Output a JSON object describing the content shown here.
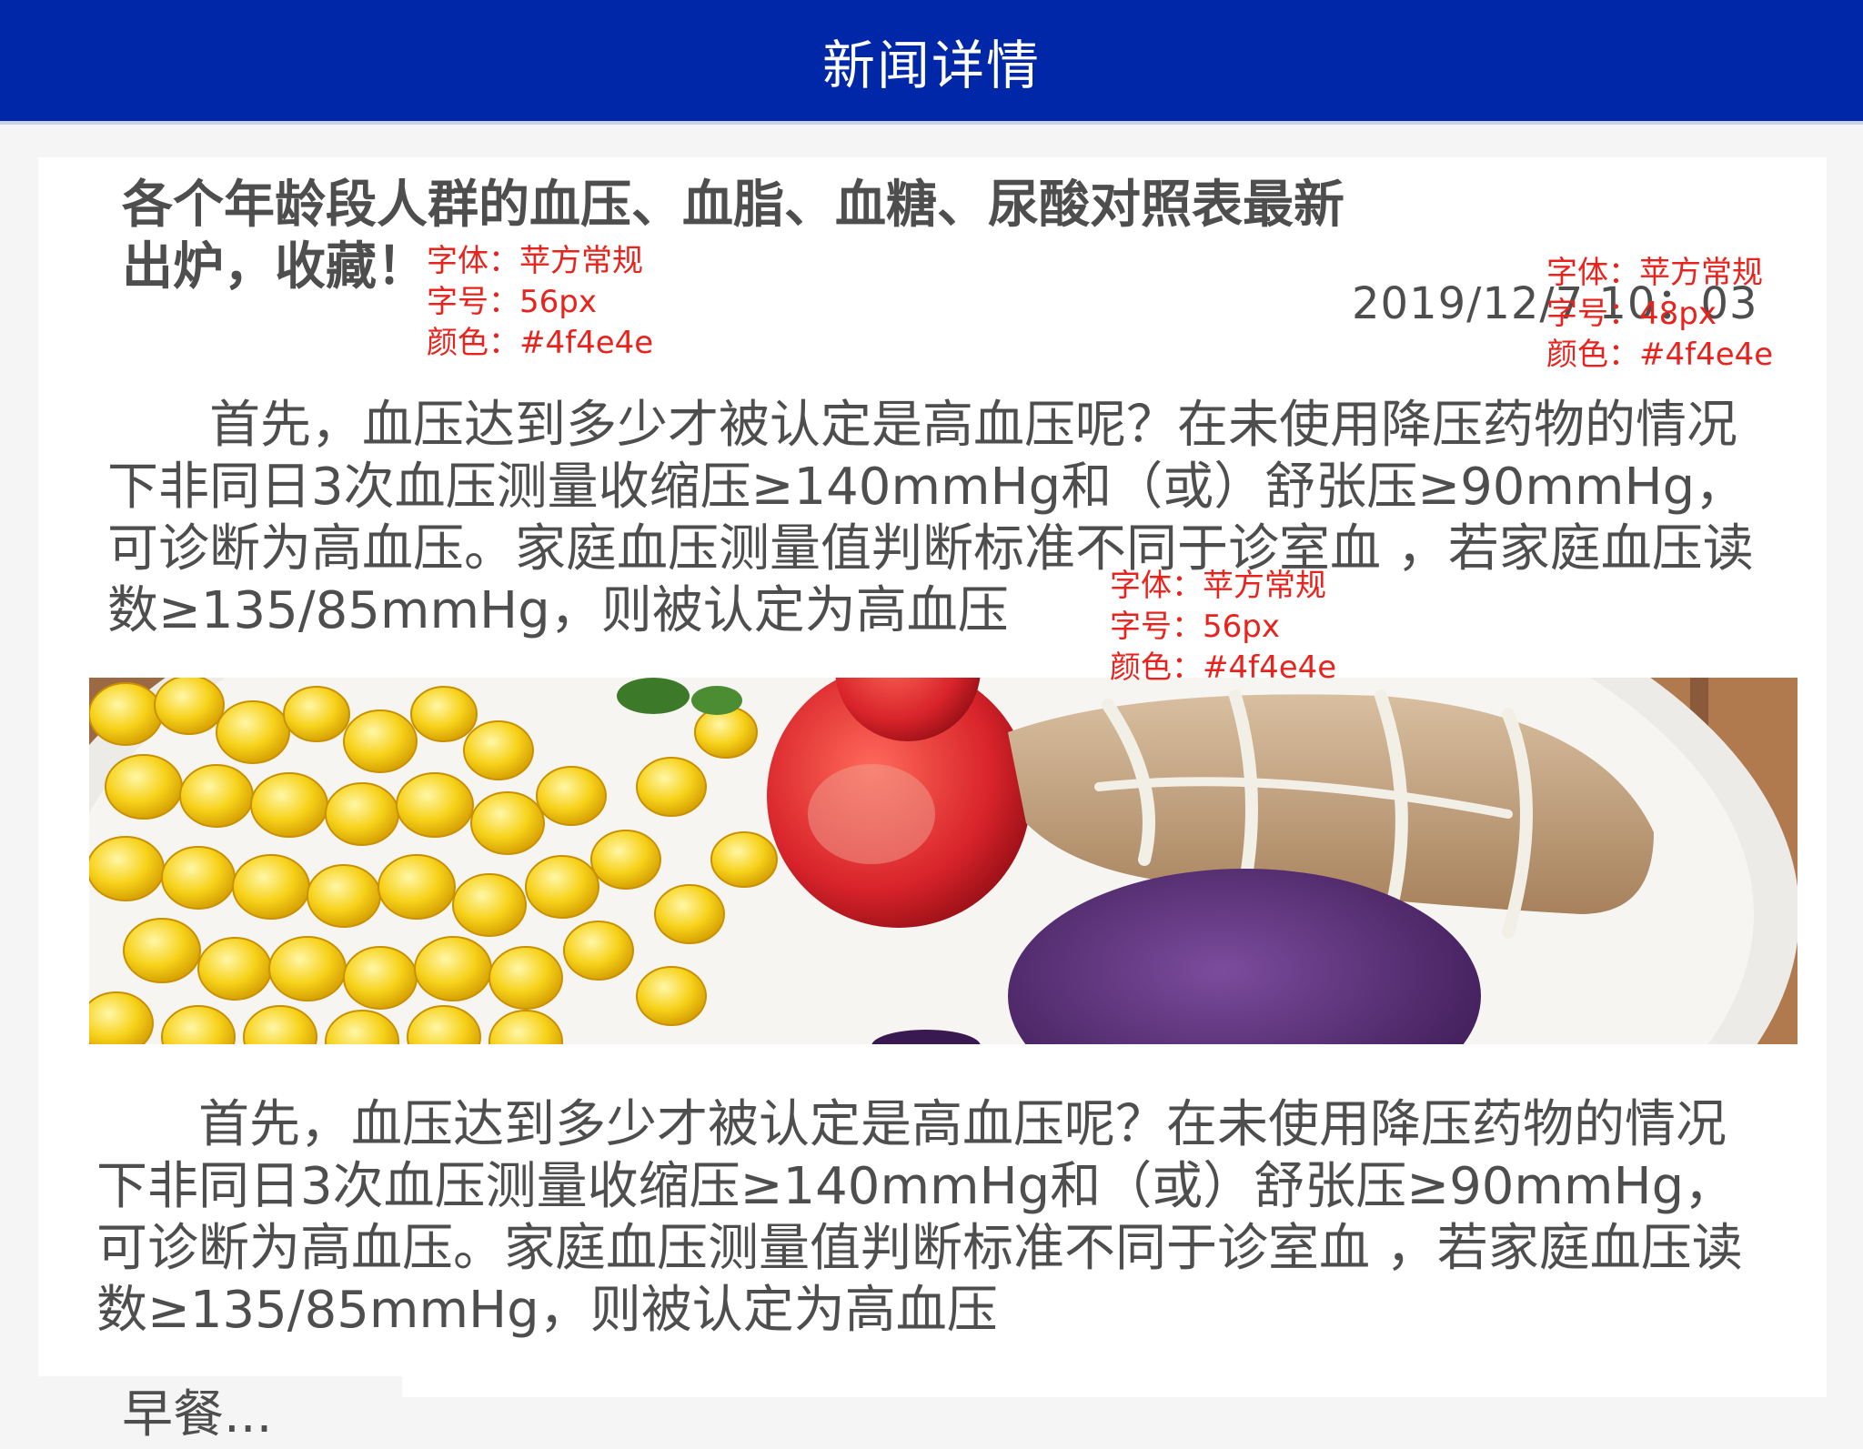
{
  "header": {
    "title": "新闻详情"
  },
  "article": {
    "title": "各个年龄段人群的血压、血脂、血糖、尿酸对照表最新出炉，收藏！",
    "date": "2019/12/7 10：03",
    "paragraphs": [
      "首先，血压达到多少才被认定是高血压呢？在未使用降压药物的情况下非同日3次血压测量收缩压≥140mmHg和（或）舒张压≥90mmHg，可诊断为高血压。家庭血压测量值判断标准不同于诊室血 ，若家庭血压读数≥135/85mmHg，则被认定为高血压",
      "首先，血压达到多少才被认定是高血压呢？在未使用降压药物的情况下非同日3次血压测量收缩压≥140mmHg和（或）舒张压≥90mmHg，可诊断为高血压。家庭血压测量值判断标准不同于诊室血 ，若家庭血压读数≥135/85mmHg，则被认定为高血压"
    ],
    "image_subject": "food-plate-photo",
    "bottom_partial_text": "早餐..."
  },
  "annotations": {
    "title_spec": {
      "font": "字体：苹方常规",
      "size": "字号：56px",
      "color": "颜色：#4f4e4e"
    },
    "date_spec": {
      "font": "字体：苹方常规",
      "size": "字号：48px",
      "color": "颜色：#4f4e4e"
    },
    "body_spec": {
      "font": "字体：苹方常规",
      "size": "字号：56px",
      "color": "颜色：#4f4e4e"
    }
  },
  "colors": {
    "header_bg": "#0027a7",
    "text": "#4f4e4e",
    "annotation": "#e8231e",
    "page_bg": "#f5f5f5"
  }
}
